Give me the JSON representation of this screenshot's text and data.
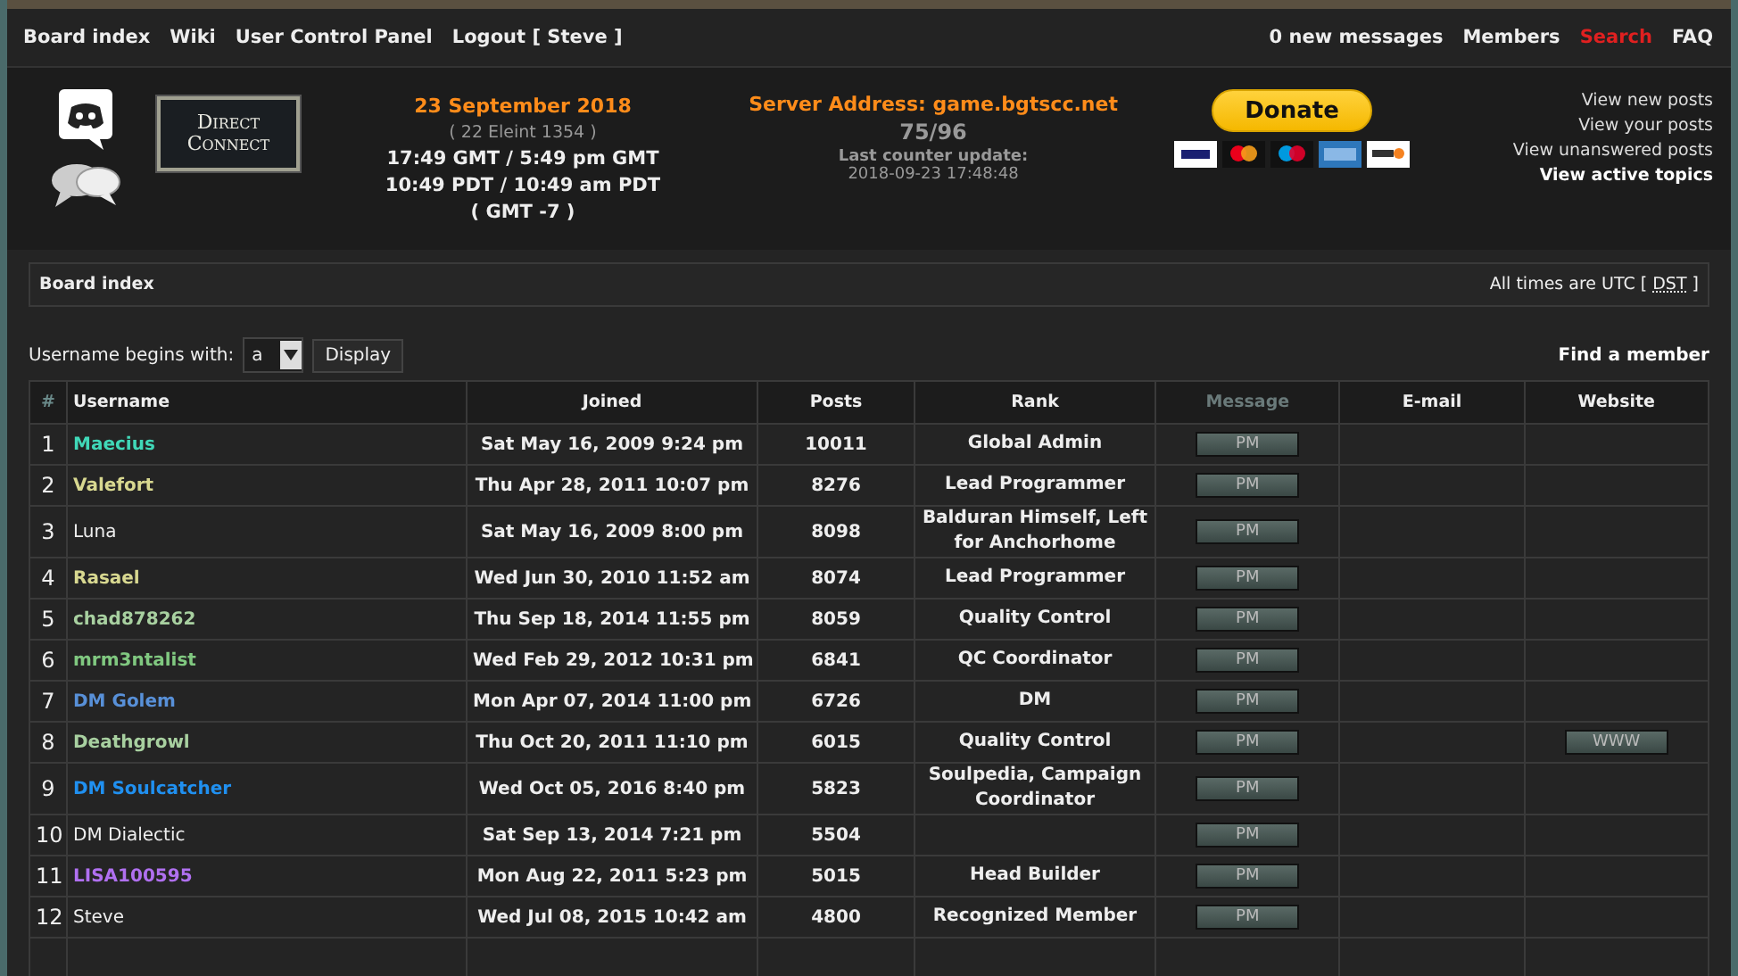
{
  "nav_left": [
    "Board index",
    "Wiki",
    "User Control Panel",
    "Logout [ Steve ]"
  ],
  "nav_right": [
    {
      "label": "0 new messages",
      "kind": "link"
    },
    {
      "label": "Members",
      "kind": "link"
    },
    {
      "label": "Search",
      "kind": "alert"
    },
    {
      "label": "FAQ",
      "kind": "link"
    }
  ],
  "header": {
    "direct_connect": "Direct Connect",
    "date": "23 September 2018",
    "game_date": "( 22 Eleint 1354 )",
    "times": [
      "17:49 GMT / 5:49 pm GMT",
      "10:49 PDT / 10:49 am PDT",
      "( GMT -7 )"
    ],
    "server": "Server Address: game.bgtscc.net",
    "players": "75/96",
    "counter_label": "Last counter update:",
    "counter_time": "2018-09-23 17:48:48",
    "donate": "Donate",
    "links": [
      {
        "label": "View new posts",
        "bold": false
      },
      {
        "label": "View your posts",
        "bold": false
      },
      {
        "label": "View unanswered posts",
        "bold": false
      },
      {
        "label": "View active topics",
        "bold": true
      }
    ]
  },
  "breadcrumb": "Board index",
  "timezone": "All times are UTC [ ",
  "dst": "DST",
  "timezone_end": " ]",
  "filter": {
    "label": "Username begins with:",
    "value": "a",
    "button": "Display"
  },
  "find_member": "Find a member",
  "table": {
    "columns": [
      "#",
      "Username",
      "Joined",
      "Posts",
      "Rank",
      "Message",
      "E-mail",
      "Website"
    ],
    "rows": [
      {
        "n": "1",
        "username": "Maecius",
        "color": "#40d8b8",
        "joined": "Sat May 16, 2009 9:24 pm",
        "posts": "10011",
        "rank": "Global Admin",
        "pm": "PM"
      },
      {
        "n": "2",
        "username": "Valefort",
        "color": "#d8d890",
        "joined": "Thu Apr 28, 2011 10:07 pm",
        "posts": "8276",
        "rank": "Lead Programmer",
        "pm": "PM"
      },
      {
        "n": "3",
        "username": "Luna",
        "joined": "Sat May 16, 2009 8:00 pm",
        "posts": "8098",
        "rank": "Balduran Himself, Left for Anchorhome",
        "pm": "PM"
      },
      {
        "n": "4",
        "username": "Rasael",
        "color": "#d8d890",
        "joined": "Wed Jun 30, 2010 11:52 am",
        "posts": "8074",
        "rank": "Lead Programmer",
        "pm": "PM"
      },
      {
        "n": "5",
        "username": "chad878262",
        "color": "#a8d0a0",
        "joined": "Thu Sep 18, 2014 11:55 pm",
        "posts": "8059",
        "rank": "Quality Control",
        "pm": "PM"
      },
      {
        "n": "6",
        "username": "mrm3ntalist",
        "color": "#80c880",
        "joined": "Wed Feb 29, 2012 10:31 pm",
        "posts": "6841",
        "rank": "QC Coordinator",
        "pm": "PM"
      },
      {
        "n": "7",
        "username": "DM Golem",
        "color": "#5890d8",
        "joined": "Mon Apr 07, 2014 11:00 pm",
        "posts": "6726",
        "rank": "DM",
        "pm": "PM"
      },
      {
        "n": "8",
        "username": "Deathgrowl",
        "color": "#a8d0a0",
        "joined": "Thu Oct 20, 2011 11:10 pm",
        "posts": "6015",
        "rank": "Quality Control",
        "pm": "PM",
        "www": "WWW"
      },
      {
        "n": "9",
        "username": "DM Soulcatcher",
        "color": "#2090f0",
        "joined": "Wed Oct 05, 2016 8:40 pm",
        "posts": "5823",
        "rank": "Soulpedia, Campaign Coordinator",
        "pm": "PM"
      },
      {
        "n": "10",
        "username": "DM Dialectic",
        "joined": "Sat Sep 13, 2014 7:21 pm",
        "posts": "5504",
        "pm": "PM"
      },
      {
        "n": "11",
        "username": "LISA100595",
        "color": "#b070f0",
        "joined": "Mon Aug 22, 2011 5:23 pm",
        "posts": "5015",
        "rank": "Head Builder",
        "pm": "PM"
      },
      {
        "n": "12",
        "username": "Steve",
        "joined": "Wed Jul 08, 2015 10:42 am",
        "posts": "4800",
        "rank": "Recognized Member",
        "pm": "PM"
      }
    ]
  }
}
